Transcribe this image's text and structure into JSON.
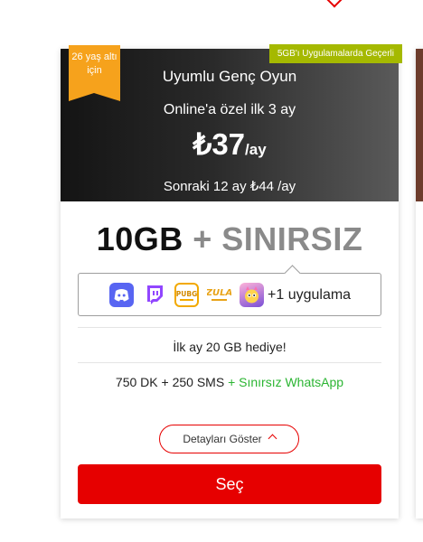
{
  "card": {
    "age_badge": "26 yaş altı için",
    "promo_badge": "5GB'ı Uygulamalarda Geçerli",
    "plan_name": "Uyumlu Genç Oyun",
    "online_offer": "Online'a özel ilk 3 ay",
    "price_amount": "₺37",
    "price_unit": "/ay",
    "next_price": "Sonraki 12 ay ₺44 /ay",
    "data_gb": "10GB",
    "data_plus": "+",
    "data_unlimited": "SINIRSIZ",
    "more_apps": "+1 uygulama",
    "apps": [
      {
        "name": "discord-icon",
        "color": "#5865f2"
      },
      {
        "name": "twitch-icon",
        "color": "#9146ff"
      },
      {
        "name": "pubg-mobile-icon",
        "color": "#f2a900"
      },
      {
        "name": "zula-mobile-icon",
        "color": "#e8a317"
      },
      {
        "name": "game-character-icon",
        "color": "#ff5aa0"
      }
    ],
    "gift_text": "İlk ay 20 GB hediye!",
    "voice_text": "750 DK + 250 SMS",
    "whatsapp_text": "+ Sınırsız WhatsApp",
    "details_label": "Detayları Göster",
    "select_label": "Seç"
  },
  "colors": {
    "brand_red": "#e60000",
    "badge_orange": "#f6a21c",
    "badge_green": "#a5b900",
    "whatsapp_green": "#2bb532"
  }
}
